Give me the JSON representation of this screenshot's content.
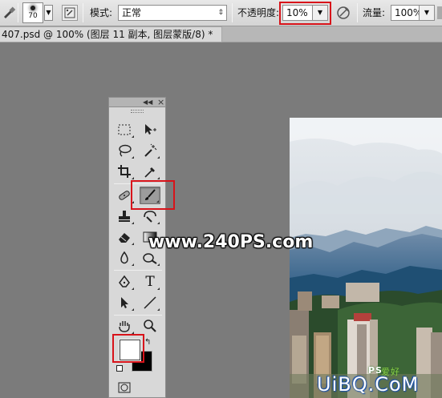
{
  "options_bar": {
    "brush_size": "70",
    "mode_label": "模式:",
    "mode_value": "正常",
    "opacity_label": "不透明度:",
    "opacity_value": "10%",
    "flow_label": "流量:",
    "flow_value": "100%"
  },
  "document": {
    "tab_title": "407.psd @ 100% (图层 11 副本, 图层蒙版/8) *"
  },
  "tools_panel": {
    "collapse_icon": "double-chevron-left",
    "close_icon": "×",
    "type_tool_glyph": "T",
    "selected_tool": "brush-tool",
    "foreground_color": "#ffffff",
    "background_color": "#000000"
  },
  "watermarks": {
    "site": "www.240PS.com",
    "uibq": "UiBQ.CoM",
    "ps_badge": "PS",
    "aihao": "爱好"
  },
  "colors": {
    "highlight": "#d8131a",
    "panel": "#d8d8d8",
    "workspace": "#7b7b7b"
  }
}
